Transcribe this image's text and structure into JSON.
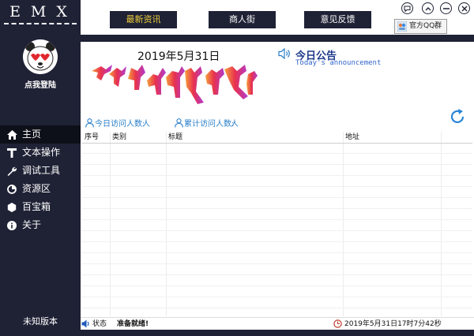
{
  "app": {
    "brand": "EMX"
  },
  "sidebar": {
    "login_label": "点我登陆",
    "items": [
      {
        "label": "主页",
        "icon": "home-icon",
        "active": true
      },
      {
        "label": "文本操作",
        "icon": "text-icon",
        "active": false
      },
      {
        "label": "调试工具",
        "icon": "wrench-icon",
        "active": false
      },
      {
        "label": "资源区",
        "icon": "pie-chart-icon",
        "active": false
      },
      {
        "label": "百宝箱",
        "icon": "hexagon-icon",
        "active": false
      },
      {
        "label": "关于",
        "icon": "info-icon",
        "active": false
      }
    ],
    "version": "未知版本"
  },
  "topbar": {
    "tabs": [
      "最新资讯",
      "商人街",
      "意见反馈"
    ],
    "qq_button": "官方QQ群"
  },
  "main": {
    "date": "2019年5月31日",
    "announcement_title": "今日公告",
    "announcement_subtitle": "Today's announcement",
    "today_visits_label": "今日访问人数:",
    "today_visits_value": "人",
    "total_visits_label": "累计访问人数:",
    "total_visits_value": "人"
  },
  "table": {
    "columns": [
      "序号",
      "类别",
      "标题",
      "地址"
    ],
    "rows": []
  },
  "statusbar": {
    "status_label": "状态",
    "status_value": "准备就绪!",
    "datetime": "2019年5月31日17时7分42秒"
  },
  "colors": {
    "sidebar_bg": "#1f2235",
    "active_tab_text": "#f0cf3c",
    "link_blue": "#2a7fc9",
    "announce_blue": "#1e3a8a"
  }
}
